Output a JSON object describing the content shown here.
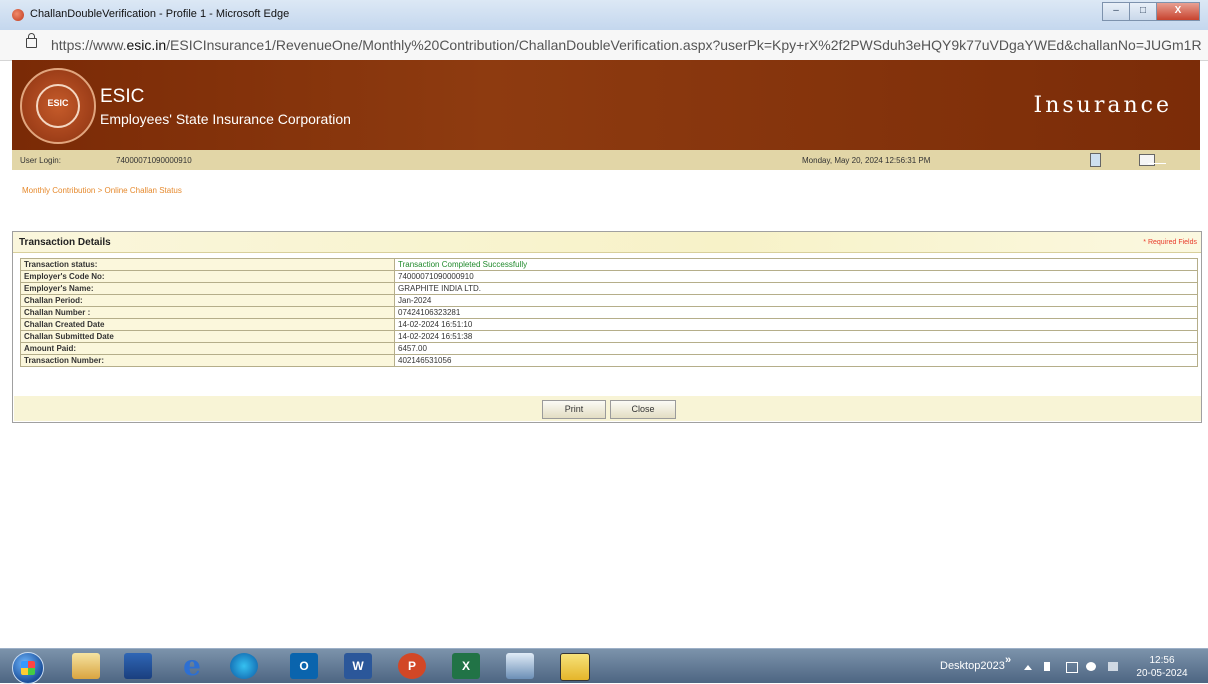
{
  "window": {
    "title": "ChallanDoubleVerification - Profile 1 - Microsoft Edge",
    "minimize_label": "–",
    "maximize_label": "□",
    "close_label": "X"
  },
  "address_bar": {
    "url_prefix": "https://www.",
    "url_domain": "esic.in",
    "url_path": "/ESICInsurance1/RevenueOne/Monthly%20Contribution/ChallanDoubleVerification.aspx?userPk=Kpy+rX%2f2PWSduh3eHQY9k77uVDgaYWEd&challanNo=JUGm1R..."
  },
  "header": {
    "logo_text": "ESIC",
    "org_short": "ESIC",
    "org_full": "Employees' State Insurance Corporation",
    "right_title": "Insurance"
  },
  "user_bar": {
    "login_label": "User Login:",
    "login_value": "74000071090000910",
    "datetime": "Monday, May 20, 2024 12:56:31 PM"
  },
  "breadcrumb": "Monthly Contribution > Online Challan Status",
  "panel": {
    "title": "Transaction Details",
    "required_note": "* Required Fields",
    "rows": [
      {
        "label": "Transaction status:",
        "value": "Transaction Completed Successfully"
      },
      {
        "label": "Employer's Code No:",
        "value": "74000071090000910"
      },
      {
        "label": "Employer's Name:",
        "value": "GRAPHITE INDIA LTD."
      },
      {
        "label": "Challan Period:",
        "value": "Jan-2024"
      },
      {
        "label": "Challan Number :",
        "value": "07424106323281"
      },
      {
        "label": "Challan Created Date",
        "value": "14-02-2024 16:51:10"
      },
      {
        "label": "Challan Submitted Date",
        "value": "14-02-2024 16:51:38"
      },
      {
        "label": "Amount Paid:",
        "value": "6457.00"
      },
      {
        "label": "Transaction Number:",
        "value": "402146531056"
      }
    ],
    "print_label": "Print",
    "close_label": "Close"
  },
  "taskbar": {
    "apps": [
      "start-orb",
      "windows-explorer",
      "media-player",
      "internet-explorer",
      "microsoft-edge",
      "outlook",
      "word",
      "powerpoint",
      "excel",
      "scanner",
      "sticky-notes"
    ],
    "desktop_label": "Desktop2023",
    "overflow_label": "»",
    "ie_glyph": "e",
    "outlook_glyph": "O",
    "word_glyph": "W",
    "ppt_glyph": "P",
    "excel_glyph": "X",
    "clock_time": "12:56",
    "clock_date": "20-05-2024"
  },
  "colors": {
    "header_brown": "#7a2a06",
    "user_bar": "#e2d6a7",
    "breadcrumb": "#e68a2e",
    "success": "#208a2c",
    "required": "#e83b2a"
  }
}
